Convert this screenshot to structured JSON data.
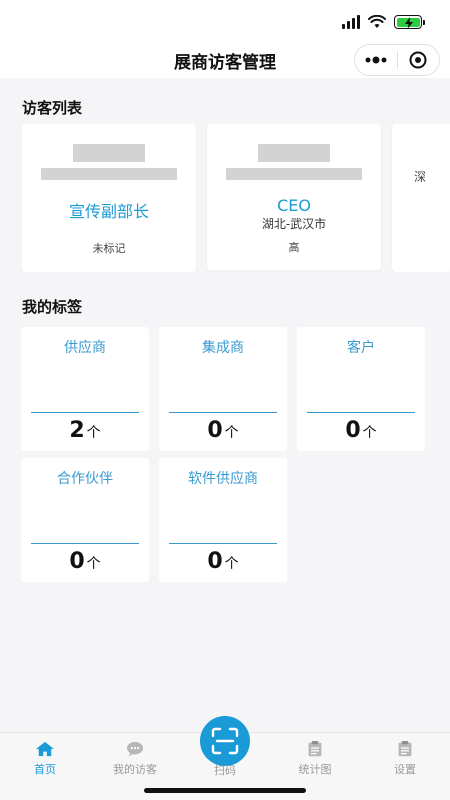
{
  "nav": {
    "title": "展商访客管理"
  },
  "visitors": {
    "section_title": "访客列表",
    "cards": [
      {
        "title": "宣传副部长",
        "location": "",
        "mark": "未标记"
      },
      {
        "title": "CEO",
        "location": "湖北-武汉市",
        "mark": "高"
      },
      {
        "title": "",
        "location": "深",
        "mark": ""
      }
    ]
  },
  "tags": {
    "section_title": "我的标签",
    "unit": "个",
    "items": [
      {
        "name": "供应商",
        "count": "2"
      },
      {
        "name": "集成商",
        "count": "0"
      },
      {
        "name": "客户",
        "count": "0"
      },
      {
        "name": "合作伙伴",
        "count": "0"
      },
      {
        "name": "软件供应商",
        "count": "0"
      }
    ]
  },
  "tabbar": {
    "home": "首页",
    "visitors": "我的访客",
    "scan": "扫码",
    "stats": "统计图",
    "settings": "设置"
  },
  "colors": {
    "accent": "#1a9ad6",
    "tag_text": "#3a9bd0",
    "background": "#f5f5f7",
    "battery": "#2ecc40"
  },
  "icons": {
    "status": [
      "signal-icon",
      "wifi-icon",
      "battery-icon"
    ],
    "capsule": [
      "more-icon",
      "close-target-icon"
    ],
    "tabs": [
      "home-icon",
      "chat-icon",
      "scan-icon",
      "stats-icon",
      "settings-icon"
    ]
  }
}
